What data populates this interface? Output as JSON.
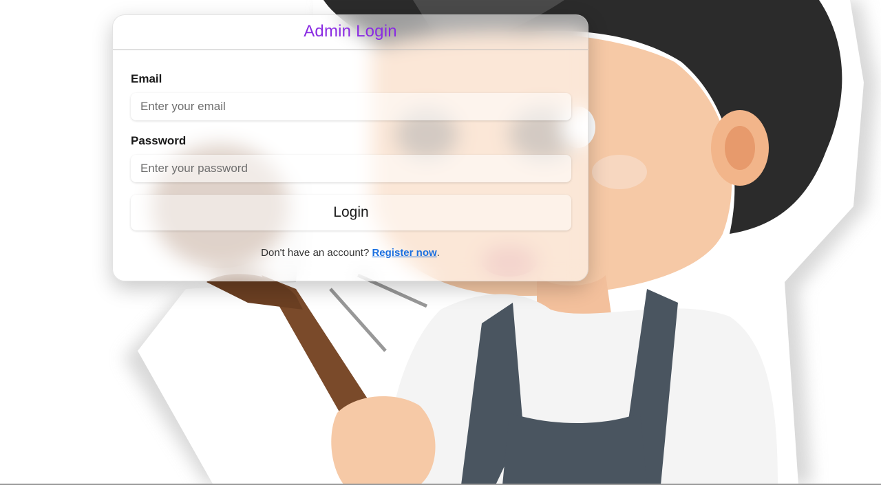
{
  "login": {
    "title": "Admin Login",
    "email_label": "Email",
    "email_placeholder": "Enter your email",
    "password_label": "Password",
    "password_placeholder": "Enter your password",
    "button_label": "Login",
    "register_prompt": "Don't have an account?",
    "register_link": "Register now",
    "register_suffix": "."
  },
  "colors": {
    "title": "#8a2be2",
    "link": "#1a6fe0"
  }
}
